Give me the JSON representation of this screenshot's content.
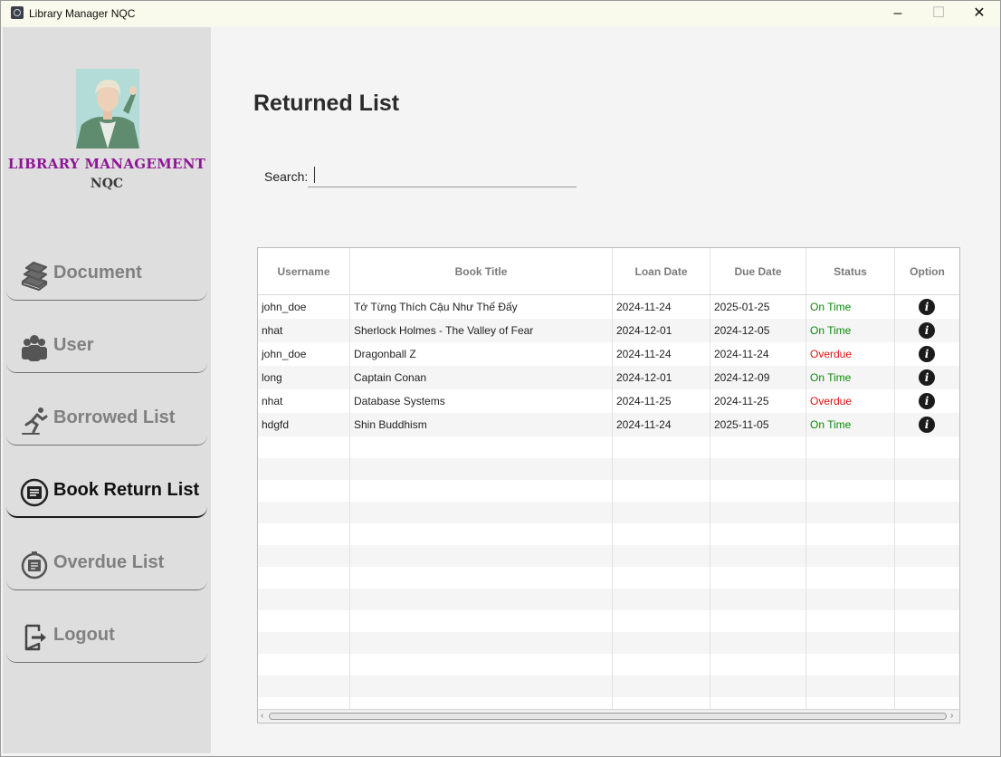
{
  "window": {
    "title": "Library Manager NQC",
    "minimize": "–",
    "maximize": "☐",
    "close": "✕"
  },
  "sidebar": {
    "brand_line1": "LIBRARY MANAGEMENT",
    "brand_line2": "NQC",
    "items": [
      {
        "label": "Document",
        "icon": "books-icon",
        "active": false
      },
      {
        "label": "User",
        "icon": "users-icon",
        "active": false
      },
      {
        "label": "Borrowed List",
        "icon": "runner-icon",
        "active": false
      },
      {
        "label": "Book Return List",
        "icon": "book-return-icon",
        "active": true
      },
      {
        "label": "Overdue List",
        "icon": "overdue-clock-icon",
        "active": false
      },
      {
        "label": "Logout",
        "icon": "logout-icon",
        "active": false
      }
    ]
  },
  "main": {
    "title": "Returned List",
    "search": {
      "label": "Search:",
      "value": "",
      "placeholder": ""
    }
  },
  "table": {
    "columns": [
      "Username",
      "Book Title",
      "Loan Date",
      "Due Date",
      "Status",
      "Option"
    ],
    "rows": [
      {
        "username": "john_doe",
        "title": "Tớ Từng Thích Cậu Như Thế Đấy",
        "loan": "2024-11-24",
        "due": "2025-01-25",
        "status": "On Time"
      },
      {
        "username": "nhat",
        "title": "Sherlock Holmes - The Valley of Fear",
        "loan": "2024-12-01",
        "due": "2024-12-05",
        "status": "On Time"
      },
      {
        "username": "john_doe",
        "title": "Dragonball Z",
        "loan": "2024-11-24",
        "due": "2024-11-24",
        "status": "Overdue"
      },
      {
        "username": "long",
        "title": "Captain Conan",
        "loan": "2024-12-01",
        "due": "2024-12-09",
        "status": "On Time"
      },
      {
        "username": "nhat",
        "title": "Database Systems",
        "loan": "2024-11-25",
        "due": "2024-11-25",
        "status": "Overdue"
      },
      {
        "username": "hdgfd",
        "title": "Shin Buddhism",
        "loan": "2024-11-24",
        "due": "2025-11-05",
        "status": "On Time"
      }
    ],
    "option_glyph": "i",
    "status_colors": {
      "On Time": "#0a8a0a",
      "Overdue": "#e01010"
    }
  }
}
